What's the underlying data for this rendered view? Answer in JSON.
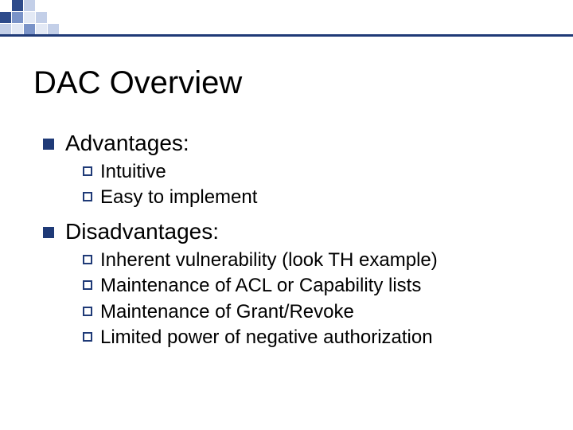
{
  "title": "DAC Overview",
  "sections": [
    {
      "heading": "Advantages:",
      "items": [
        "Intuitive",
        "Easy to implement"
      ]
    },
    {
      "heading": "Disadvantages:",
      "items": [
        "Inherent vulnerability (look TH example)",
        "Maintenance of ACL or Capability lists",
        "Maintenance of Grant/Revoke",
        "Limited power of negative authorization"
      ]
    }
  ]
}
